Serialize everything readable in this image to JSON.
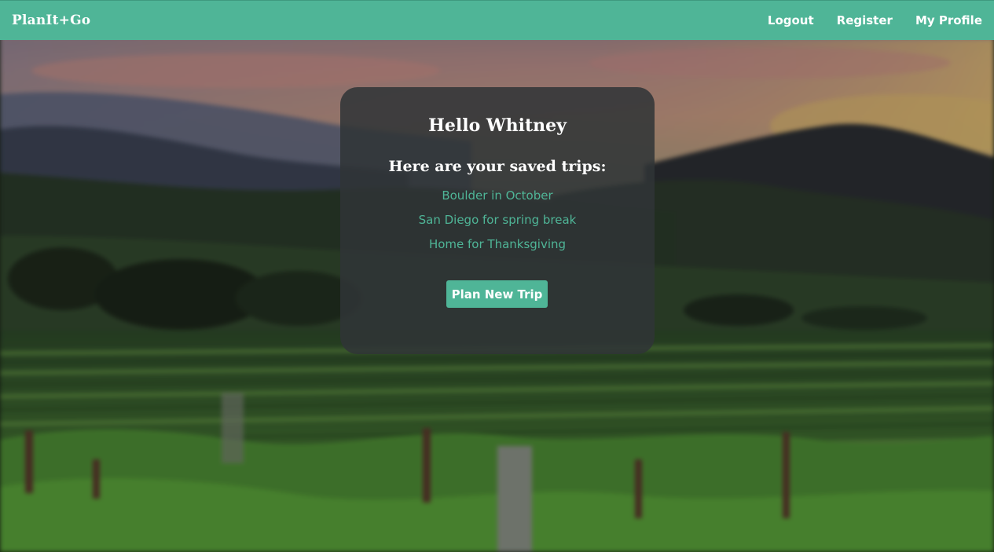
{
  "navbar": {
    "brand": "PlanIt+Go",
    "links": [
      {
        "label": "Logout"
      },
      {
        "label": "Register"
      },
      {
        "label": "My Profile"
      }
    ],
    "color": "#4fb597"
  },
  "card": {
    "greeting": "Hello Whitney",
    "subheading": "Here are your saved trips:",
    "trips": [
      {
        "label": "Boulder in October"
      },
      {
        "label": "San Diego for spring break"
      },
      {
        "label": "Home for Thanksgiving"
      }
    ],
    "plan_button_label": "Plan New Trip"
  },
  "colors": {
    "accent": "#4fb597",
    "card_background": "#303437"
  }
}
